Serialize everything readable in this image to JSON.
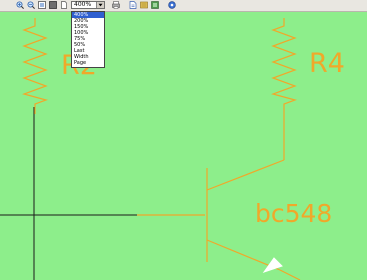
{
  "toolbar": {
    "buttons": [
      {
        "name": "zoom-in-icon"
      },
      {
        "name": "zoom-out-icon"
      },
      {
        "name": "zoom-fit-icon"
      },
      {
        "name": "page-view-icon"
      },
      {
        "name": "new-page-icon"
      },
      {
        "name": "print-icon"
      },
      {
        "name": "export-icon"
      },
      {
        "name": "page-setup-icon"
      },
      {
        "name": "layers-icon"
      },
      {
        "name": "help-icon"
      }
    ],
    "zoom": {
      "selected": "400%",
      "options": [
        "400%",
        "200%",
        "150%",
        "100%",
        "75%",
        "50%",
        "Last",
        "Width",
        "Page"
      ]
    }
  },
  "schematic": {
    "labels": {
      "r2": "R2",
      "r4": "R4",
      "transistor": "bc548"
    },
    "colors": {
      "background": "#8dee8b",
      "component": "#f0a82a",
      "wire": "#1a1a1a"
    }
  }
}
